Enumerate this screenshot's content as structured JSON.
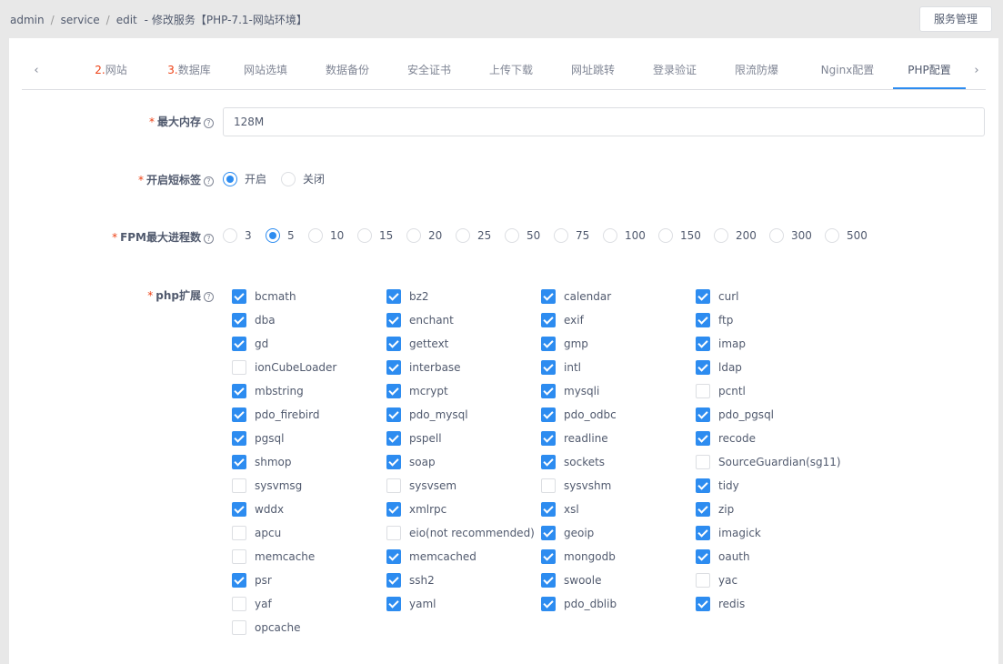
{
  "breadcrumb": {
    "items": [
      "admin",
      "service",
      "edit"
    ],
    "dash": "-",
    "title": "修改服务【PHP-7.1-网站环境】"
  },
  "header": {
    "service_button": "服务管理"
  },
  "tabs": {
    "prev_icon": "chevron-left-icon",
    "next_icon": "chevron-right-icon",
    "items": [
      {
        "num": "2.",
        "label": "网站"
      },
      {
        "num": "3.",
        "label": "数据库"
      },
      {
        "num": "",
        "label": "网站选填"
      },
      {
        "num": "",
        "label": "数据备份"
      },
      {
        "num": "",
        "label": "安全证书"
      },
      {
        "num": "",
        "label": "上传下载"
      },
      {
        "num": "",
        "label": "网址跳转"
      },
      {
        "num": "",
        "label": "登录验证"
      },
      {
        "num": "",
        "label": "限流防爆"
      },
      {
        "num": "",
        "label": "Nginx配置"
      },
      {
        "num": "",
        "label": "PHP配置"
      }
    ],
    "active": "PHP配置"
  },
  "form": {
    "required_mark": "*",
    "help_glyph": "?",
    "memory": {
      "label": "最大内存",
      "value": "128M"
    },
    "short_tag": {
      "label": "开启短标签",
      "options": [
        "开启",
        "关闭"
      ],
      "selected": "开启"
    },
    "fpm": {
      "label": "FPM最大进程数",
      "options": [
        "3",
        "5",
        "10",
        "15",
        "20",
        "25",
        "50",
        "75",
        "100",
        "150",
        "200",
        "300",
        "500"
      ],
      "selected": "5"
    },
    "extensions": {
      "label": "php扩展",
      "items": [
        {
          "name": "bcmath",
          "checked": true
        },
        {
          "name": "bz2",
          "checked": true
        },
        {
          "name": "calendar",
          "checked": true
        },
        {
          "name": "curl",
          "checked": true
        },
        {
          "name": "dba",
          "checked": true
        },
        {
          "name": "enchant",
          "checked": true
        },
        {
          "name": "exif",
          "checked": true
        },
        {
          "name": "ftp",
          "checked": true
        },
        {
          "name": "gd",
          "checked": true
        },
        {
          "name": "gettext",
          "checked": true
        },
        {
          "name": "gmp",
          "checked": true
        },
        {
          "name": "imap",
          "checked": true
        },
        {
          "name": "ionCubeLoader",
          "checked": false
        },
        {
          "name": "interbase",
          "checked": true
        },
        {
          "name": "intl",
          "checked": true
        },
        {
          "name": "ldap",
          "checked": true
        },
        {
          "name": "mbstring",
          "checked": true
        },
        {
          "name": "mcrypt",
          "checked": true
        },
        {
          "name": "mysqli",
          "checked": true
        },
        {
          "name": "pcntl",
          "checked": false
        },
        {
          "name": "pdo_firebird",
          "checked": true
        },
        {
          "name": "pdo_mysql",
          "checked": true
        },
        {
          "name": "pdo_odbc",
          "checked": true
        },
        {
          "name": "pdo_pgsql",
          "checked": true
        },
        {
          "name": "pgsql",
          "checked": true
        },
        {
          "name": "pspell",
          "checked": true
        },
        {
          "name": "readline",
          "checked": true
        },
        {
          "name": "recode",
          "checked": true
        },
        {
          "name": "shmop",
          "checked": true
        },
        {
          "name": "soap",
          "checked": true
        },
        {
          "name": "sockets",
          "checked": true
        },
        {
          "name": "SourceGuardian(sg11)",
          "checked": false
        },
        {
          "name": "sysvmsg",
          "checked": false
        },
        {
          "name": "sysvsem",
          "checked": false
        },
        {
          "name": "sysvshm",
          "checked": false
        },
        {
          "name": "tidy",
          "checked": true
        },
        {
          "name": "wddx",
          "checked": true
        },
        {
          "name": "xmlrpc",
          "checked": true
        },
        {
          "name": "xsl",
          "checked": true
        },
        {
          "name": "zip",
          "checked": true
        },
        {
          "name": "apcu",
          "checked": false
        },
        {
          "name": "eio(not recommended)",
          "checked": false
        },
        {
          "name": "geoip",
          "checked": true
        },
        {
          "name": "imagick",
          "checked": true
        },
        {
          "name": "memcache",
          "checked": false
        },
        {
          "name": "memcached",
          "checked": true
        },
        {
          "name": "mongodb",
          "checked": true
        },
        {
          "name": "oauth",
          "checked": true
        },
        {
          "name": "psr",
          "checked": true
        },
        {
          "name": "ssh2",
          "checked": true
        },
        {
          "name": "swoole",
          "checked": true
        },
        {
          "name": "yac",
          "checked": false
        },
        {
          "name": "yaf",
          "checked": false
        },
        {
          "name": "yaml",
          "checked": true
        },
        {
          "name": "pdo_dblib",
          "checked": true
        },
        {
          "name": "redis",
          "checked": true
        },
        {
          "name": "opcache",
          "checked": false
        }
      ]
    }
  },
  "colors": {
    "accent": "#2d8cf0",
    "required": "#ed4014"
  }
}
